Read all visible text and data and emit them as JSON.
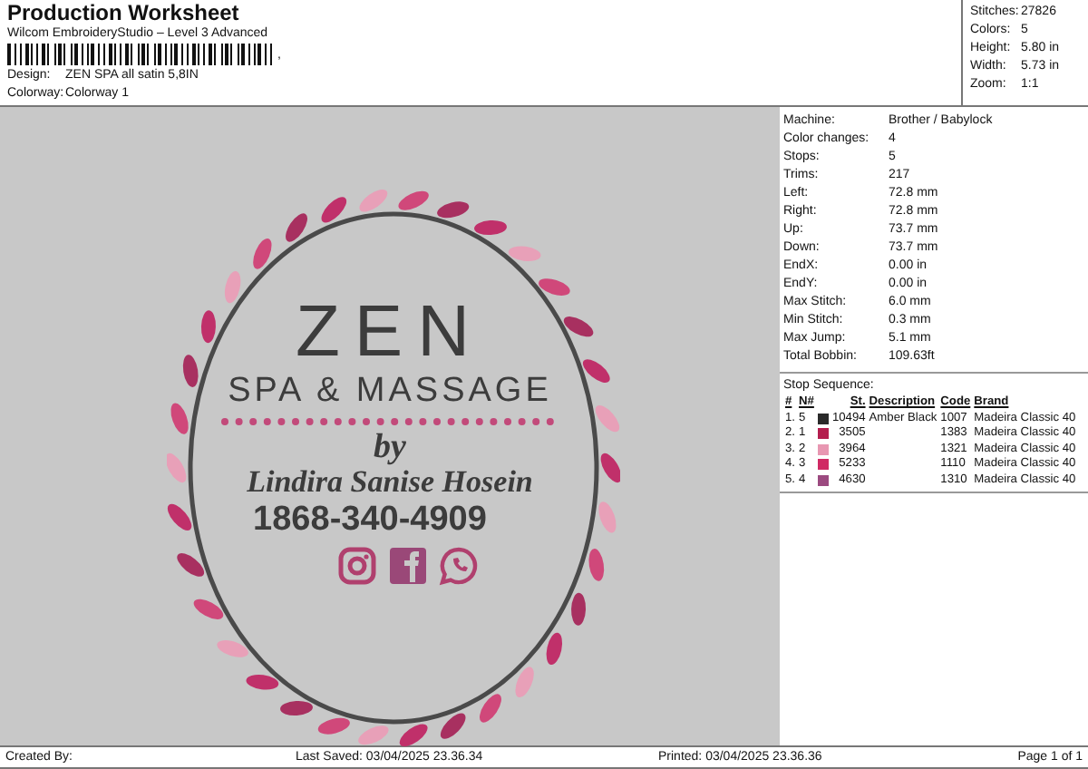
{
  "header": {
    "title": "Production Worksheet",
    "subtitle": "Wilcom EmbroideryStudio – Level 3 Advanced",
    "barcode_suffix": ",",
    "fields": [
      {
        "label": "Design:",
        "value": "ZEN SPA all satin 5,8IN"
      },
      {
        "label": "Colorway:",
        "value": "Colorway 1"
      }
    ]
  },
  "summary": [
    {
      "label": "Stitches:",
      "value": "27826"
    },
    {
      "label": "Colors:",
      "value": "5"
    },
    {
      "label": "Height:",
      "value": "5.80 in"
    },
    {
      "label": "Width:",
      "value": "5.73 in"
    },
    {
      "label": "Zoom:",
      "value": "1:1"
    }
  ],
  "design": {
    "title": "ZEN",
    "subtitle": "SPA & MASSAGE",
    "by": "by",
    "name": "Lindira Sanise Hosein",
    "phone": "1868-340-4909"
  },
  "details": [
    {
      "label": "Machine:",
      "value": "Brother / Babylock"
    },
    {
      "label": "Color changes:",
      "value": "4"
    },
    {
      "label": "Stops:",
      "value": "5"
    },
    {
      "label": "Trims:",
      "value": "217"
    },
    {
      "label": "Left:",
      "value": "72.8 mm"
    },
    {
      "label": "Right:",
      "value": "72.8 mm"
    },
    {
      "label": "Up:",
      "value": "73.7 mm"
    },
    {
      "label": "Down:",
      "value": "73.7 mm"
    },
    {
      "label": "EndX:",
      "value": "0.00 in"
    },
    {
      "label": "EndY:",
      "value": "0.00 in"
    },
    {
      "label": "Max Stitch:",
      "value": "6.0 mm"
    },
    {
      "label": "Min Stitch:",
      "value": "0.3 mm"
    },
    {
      "label": "Max Jump:",
      "value": "5.1 mm"
    },
    {
      "label": "Total Bobbin:",
      "value": "109.63ft"
    }
  ],
  "stop_sequence": {
    "title": "Stop Sequence:",
    "columns": [
      "#",
      "N#",
      "St.",
      "Description",
      "Code",
      "Brand"
    ],
    "rows": [
      {
        "index": "1.",
        "n": "5",
        "color": "#2a2a2a",
        "stitches": "10494",
        "description": "Amber Black",
        "code": "1007",
        "brand": "Madeira Classic 40"
      },
      {
        "index": "2.",
        "n": "1",
        "color": "#b41e4e",
        "stitches": "3505",
        "code": "1383",
        "brand": "Madeira Classic 40"
      },
      {
        "index": "3.",
        "n": "2",
        "color": "#e897b2",
        "stitches": "3964",
        "code": "1321",
        "brand": "Madeira Classic 40"
      },
      {
        "index": "4.",
        "n": "3",
        "color": "#d02a64",
        "stitches": "5233",
        "code": "1110",
        "brand": "Madeira Classic 40"
      },
      {
        "index": "5.",
        "n": "4",
        "color": "#9c4a80",
        "stitches": "4630",
        "code": "1310",
        "brand": "Madeira Classic 40"
      }
    ]
  },
  "footer": {
    "created_by": "Created By:",
    "last_saved": "Last Saved: 03/04/2025 23.36.34",
    "printed": "Printed: 03/04/2025 23.36.36",
    "page": "Page 1 of 1"
  }
}
